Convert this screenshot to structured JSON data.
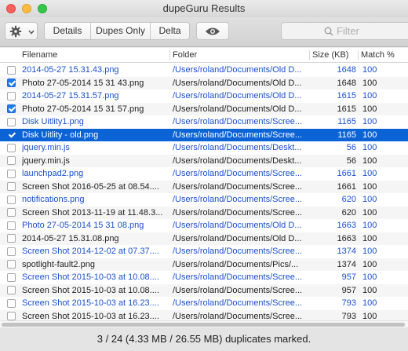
{
  "window": {
    "title": "dupeGuru Results"
  },
  "toolbar": {
    "details_label": "Details",
    "dupes_only_label": "Dupes Only",
    "delta_label": "Delta",
    "search_placeholder": "Filter"
  },
  "columns": {
    "filename": "Filename",
    "folder": "Folder",
    "size": "Size (KB)",
    "match": "Match %"
  },
  "rows": [
    {
      "kind": "ref",
      "checked": false,
      "name": "2014-05-27 15.31.43.png",
      "folder": "/Users/roland/Documents/Old D...",
      "size": "1648",
      "match": "100"
    },
    {
      "kind": "dup",
      "checked": true,
      "name": "Photo 27-05-2014 15 31 43.png",
      "folder": "/Users/roland/Documents/Old D...",
      "size": "1648",
      "match": "100"
    },
    {
      "kind": "ref",
      "checked": false,
      "name": "2014-05-27 15.31.57.png",
      "folder": "/Users/roland/Documents/Old D...",
      "size": "1615",
      "match": "100"
    },
    {
      "kind": "dup",
      "checked": true,
      "name": "Photo 27-05-2014 15 31 57.png",
      "folder": "/Users/roland/Documents/Old D...",
      "size": "1615",
      "match": "100"
    },
    {
      "kind": "ref",
      "checked": false,
      "name": "Disk Uitlity1.png",
      "folder": "/Users/roland/Documents/Scree...",
      "size": "1165",
      "match": "100"
    },
    {
      "kind": "dup",
      "checked": true,
      "selected": true,
      "name": "Disk Uitlity - old.png",
      "folder": "/Users/roland/Documents/Scree...",
      "size": "1165",
      "match": "100"
    },
    {
      "kind": "ref",
      "checked": false,
      "name": "jquery.min.js",
      "folder": "/Users/roland/Documents/Deskt...",
      "size": "56",
      "match": "100"
    },
    {
      "kind": "dup",
      "checked": false,
      "name": "jquery.min.js",
      "folder": "/Users/roland/Documents/Deskt...",
      "size": "56",
      "match": "100"
    },
    {
      "kind": "ref",
      "checked": false,
      "name": "launchpad2.png",
      "folder": "/Users/roland/Documents/Scree...",
      "size": "1661",
      "match": "100"
    },
    {
      "kind": "dup",
      "checked": false,
      "name": "Screen Shot 2016-05-25 at 08.54....",
      "folder": "/Users/roland/Documents/Scree...",
      "size": "1661",
      "match": "100"
    },
    {
      "kind": "ref",
      "checked": false,
      "name": "notifications.png",
      "folder": "/Users/roland/Documents/Scree...",
      "size": "620",
      "match": "100"
    },
    {
      "kind": "dup",
      "checked": false,
      "name": "Screen Shot 2013-11-19 at 11.48.3...",
      "folder": "/Users/roland/Documents/Scree...",
      "size": "620",
      "match": "100"
    },
    {
      "kind": "ref",
      "checked": false,
      "name": "Photo 27-05-2014 15 31 08.png",
      "folder": "/Users/roland/Documents/Old D...",
      "size": "1663",
      "match": "100"
    },
    {
      "kind": "dup",
      "checked": false,
      "name": "2014-05-27 15.31.08.png",
      "folder": "/Users/roland/Documents/Old D...",
      "size": "1663",
      "match": "100"
    },
    {
      "kind": "ref",
      "checked": false,
      "name": "Screen Shot 2014-12-02 at 07.37....",
      "folder": "/Users/roland/Documents/Scree...",
      "size": "1374",
      "match": "100"
    },
    {
      "kind": "dup",
      "checked": false,
      "name": "spotlight-fault2.png",
      "folder": "/Users/roland/Documents/Pics/...",
      "size": "1374",
      "match": "100"
    },
    {
      "kind": "ref",
      "checked": false,
      "name": "Screen Shot 2015-10-03 at 10.08....",
      "folder": "/Users/roland/Documents/Scree...",
      "size": "957",
      "match": "100"
    },
    {
      "kind": "dup",
      "checked": false,
      "name": "Screen Shot 2015-10-03 at 10.08....",
      "folder": "/Users/roland/Documents/Scree...",
      "size": "957",
      "match": "100"
    },
    {
      "kind": "ref",
      "checked": false,
      "name": "Screen Shot 2015-10-03 at 16.23....",
      "folder": "/Users/roland/Documents/Scree...",
      "size": "793",
      "match": "100"
    },
    {
      "kind": "dup",
      "checked": false,
      "name": "Screen Shot 2015-10-03 at 16.23....",
      "folder": "/Users/roland/Documents/Scree...",
      "size": "793",
      "match": "100"
    }
  ],
  "status": {
    "text": "3 / 24 (4.33 MB / 26.55 MB) duplicates marked."
  },
  "colors": {
    "reference_text": "#1a4fd1",
    "selection": "#0b63d6",
    "checkbox": "#1e7cf2"
  }
}
